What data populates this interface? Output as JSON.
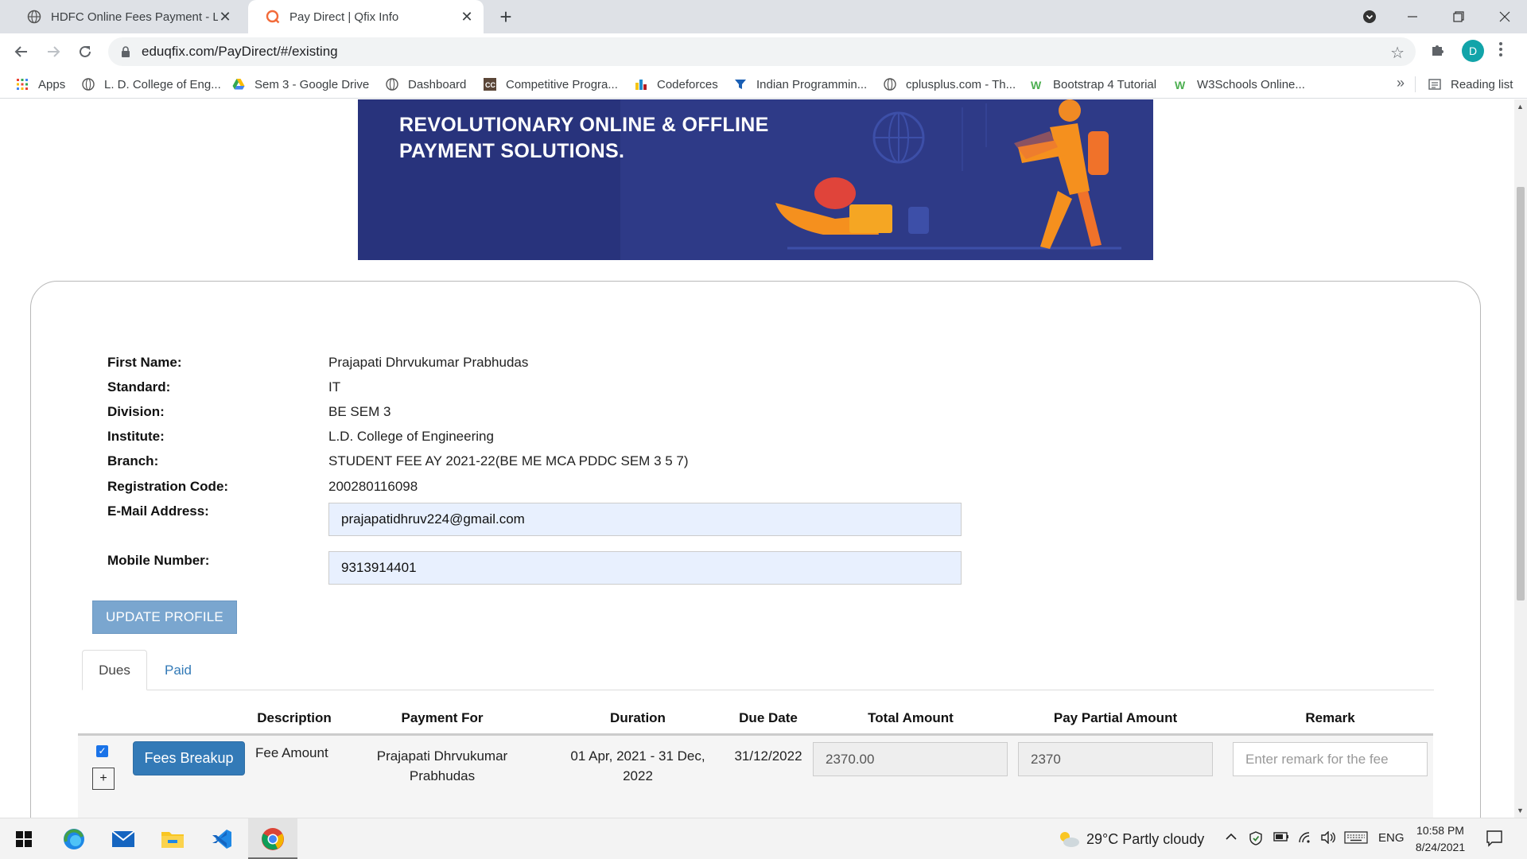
{
  "browser": {
    "tabs": [
      {
        "title": "HDFC Online Fees Payment - L. D",
        "active": false
      },
      {
        "title": "Pay Direct | Qfix Info",
        "active": true
      }
    ],
    "url": "eduqfix.com/PayDirect/#/existing",
    "profile_initial": "D",
    "bookmarks": [
      {
        "label": "Apps",
        "icon": "apps-grid-icon"
      },
      {
        "label": "L. D. College of Eng...",
        "icon": "globe-icon"
      },
      {
        "label": "Sem 3 - Google Drive",
        "icon": "google-drive-icon"
      },
      {
        "label": "Dashboard",
        "icon": "globe-icon"
      },
      {
        "label": "Competitive Progra...",
        "icon": "cc-icon"
      },
      {
        "label": "Codeforces",
        "icon": "codeforces-icon"
      },
      {
        "label": "Indian Programmin...",
        "icon": "funnel-icon"
      },
      {
        "label": "cplusplus.com - Th...",
        "icon": "globe-icon"
      },
      {
        "label": "Bootstrap 4 Tutorial",
        "icon": "w3schools-icon"
      },
      {
        "label": "W3Schools Online...",
        "icon": "w3schools-icon"
      }
    ],
    "bookmarks_more": "»",
    "reading_list": "Reading list"
  },
  "banner": {
    "line1": "REVOLUTIONARY ONLINE & OFFLINE",
    "line2": "PAYMENT SOLUTIONS."
  },
  "profile": {
    "fields": [
      {
        "label": "First Name:",
        "value": "Prajapati Dhrvukumar Prabhudas"
      },
      {
        "label": "Standard:",
        "value": "IT"
      },
      {
        "label": "Division:",
        "value": "BE SEM 3"
      },
      {
        "label": "Institute:",
        "value": "L.D. College of Engineering"
      },
      {
        "label": "Branch:",
        "value": "STUDENT FEE AY 2021-22(BE ME MCA PDDC SEM 3 5 7)"
      },
      {
        "label": "Registration Code:",
        "value": "200280116098"
      }
    ],
    "email_label": "E-Mail Address:",
    "email_value": "prajapatidhruv224@gmail.com",
    "mobile_label": "Mobile Number:",
    "mobile_value": "9313914401",
    "update_button": "UPDATE PROFILE"
  },
  "fee_tabs": [
    {
      "label": "Dues",
      "active": true
    },
    {
      "label": "Paid",
      "active": false
    }
  ],
  "fee_table": {
    "headers": [
      "Description",
      "Payment For",
      "Duration",
      "Due Date",
      "Total Amount",
      "Pay Partial Amount",
      "Remark"
    ],
    "rows": [
      {
        "checked": true,
        "expand_symbol": "+",
        "breakup_button": "Fees Breakup",
        "description": "Fee Amount",
        "payment_for_line1": "Prajapati Dhrvukumar",
        "payment_for_line2": "Prabhudas",
        "duration_line1": "01 Apr, 2021 - 31 Dec,",
        "duration_line2": "2022",
        "due_date": "31/12/2022",
        "total_amount": "2370.00",
        "partial_amount": "2370",
        "remark_placeholder": "Enter remark for the fee"
      }
    ]
  },
  "taskbar": {
    "weather": "29°C  Partly cloudy",
    "language": "ENG",
    "time": "10:58 PM",
    "date": "8/24/2021"
  }
}
